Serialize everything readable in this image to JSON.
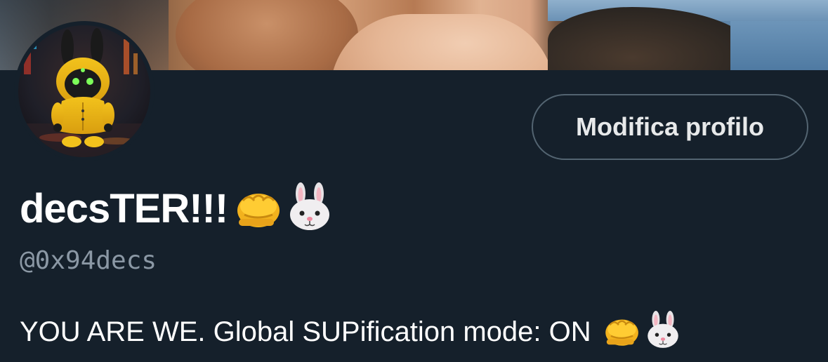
{
  "profile": {
    "edit_button_label": "Modifica profilo",
    "display_name": "decsTER!!!",
    "handle": "@0x94decs",
    "bio": "YOU ARE WE. Global SUPification mode: ON"
  },
  "icons": {
    "name_emojis": [
      "fist-bump-icon",
      "rabbit-face-icon"
    ],
    "bio_emojis": [
      "fist-bump-icon",
      "rabbit-face-icon"
    ]
  },
  "colors": {
    "background": "#15202b",
    "text_primary": "#ffffff",
    "text_secondary": "#8b98a5",
    "button_border": "#536471"
  }
}
